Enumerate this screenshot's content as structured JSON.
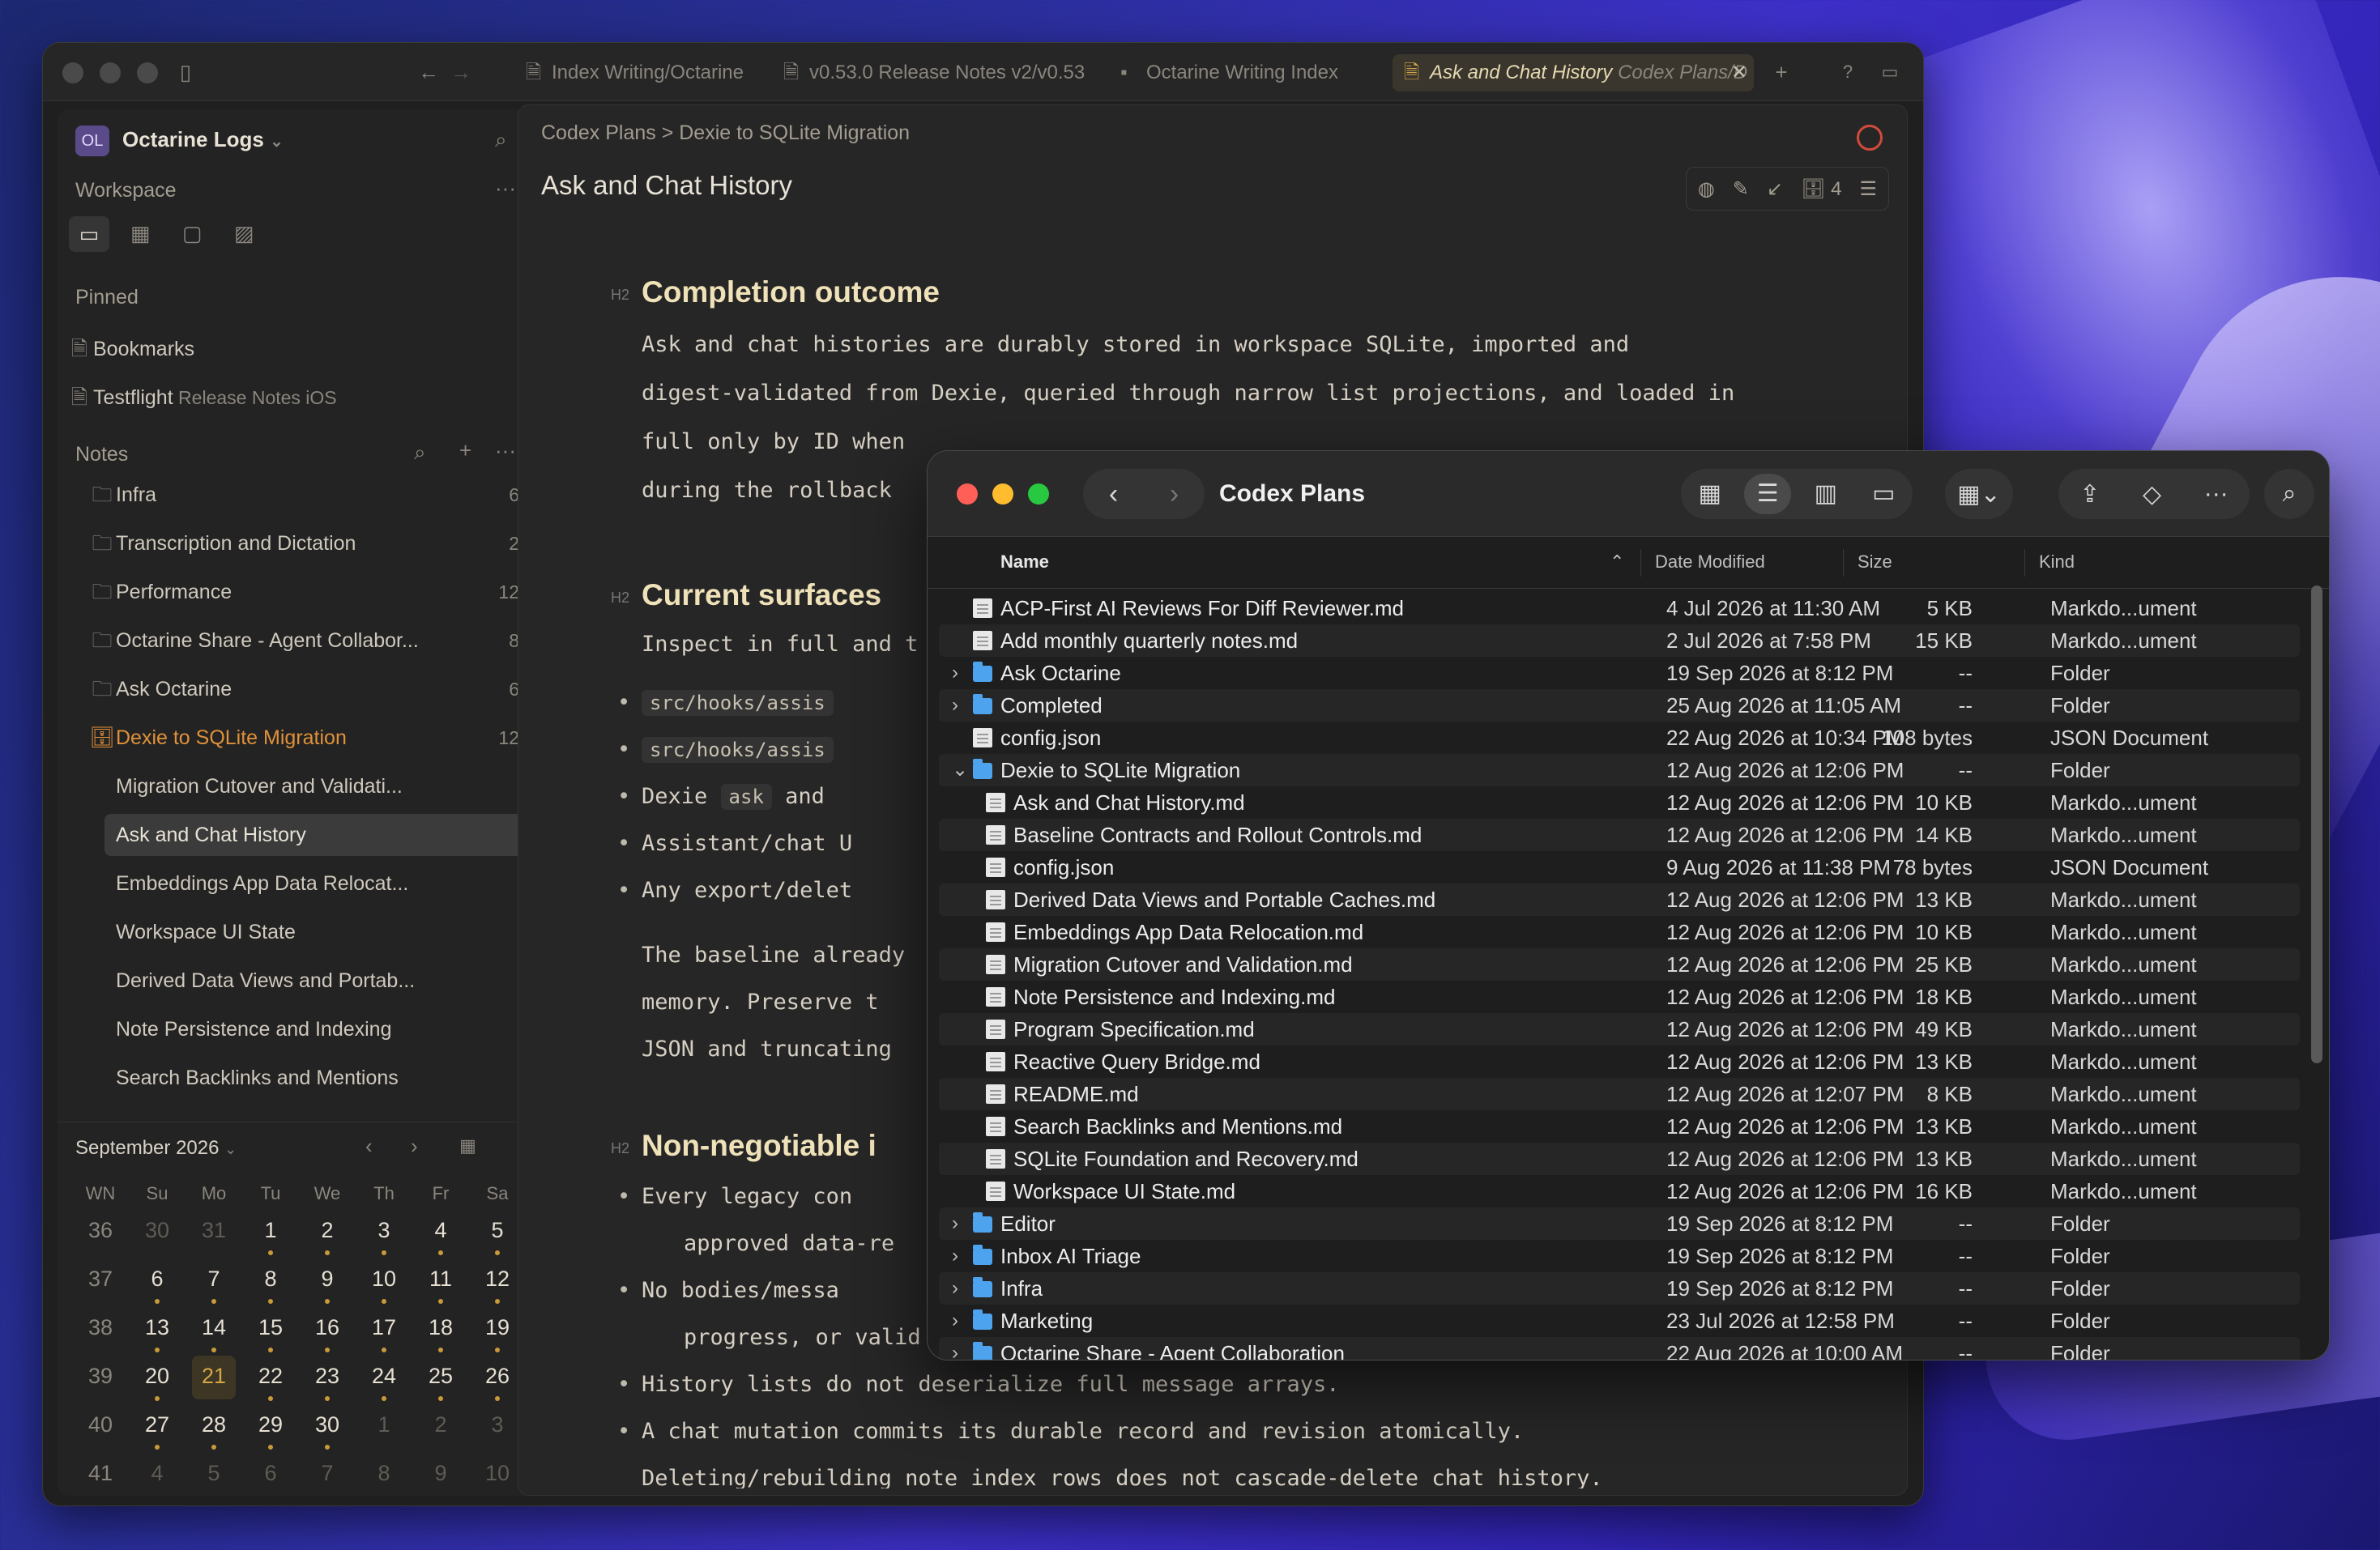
{
  "app": {
    "tabs": [
      {
        "label": "Index Writing/Octarine",
        "sub": "",
        "active": false
      },
      {
        "label": "v0.53.0 Release Notes v2/v0.53",
        "sub": "",
        "active": false
      },
      {
        "label": "Octarine Writing Index",
        "sub": "",
        "active": false
      },
      {
        "label": "Ask and Chat History",
        "sub": " Codex Plans/D",
        "active": true
      }
    ],
    "sidebar": {
      "workspace_badge": "OL",
      "workspace_name": "Octarine Logs",
      "workspace_label": "Workspace",
      "pinned_label": "Pinned",
      "pinned": [
        {
          "label": "Bookmarks",
          "sub": ""
        },
        {
          "label": "Testflight",
          "sub": " Release Notes iOS"
        }
      ],
      "notes_label": "Notes",
      "folders": [
        {
          "label": "Infra",
          "count": "6"
        },
        {
          "label": "Transcription and Dictation",
          "count": "2"
        },
        {
          "label": "Performance",
          "count": "12"
        },
        {
          "label": "Octarine Share - Agent Collabor...",
          "count": "8"
        },
        {
          "label": "Ask Octarine",
          "count": "6"
        },
        {
          "label": "Dexie to SQLite Migration",
          "count": "12"
        }
      ],
      "children": [
        "Migration Cutover and Validati...",
        "Ask and Chat History",
        "Embeddings App Data Relocat...",
        "Workspace UI State",
        "Derived Data Views and Portab...",
        "Note Persistence and Indexing",
        "Search Backlinks and Mentions"
      ],
      "calendar": {
        "month": "September 2026",
        "headers": [
          "WN",
          "Su",
          "Mo",
          "Tu",
          "We",
          "Th",
          "Fr",
          "Sa"
        ],
        "rows": [
          [
            "36",
            "30",
            "31",
            "1",
            "2",
            "3",
            "4",
            "5"
          ],
          [
            "37",
            "6",
            "7",
            "8",
            "9",
            "10",
            "11",
            "12"
          ],
          [
            "38",
            "13",
            "14",
            "15",
            "16",
            "17",
            "18",
            "19"
          ],
          [
            "39",
            "20",
            "21",
            "22",
            "23",
            "24",
            "25",
            "26"
          ],
          [
            "40",
            "27",
            "28",
            "29",
            "30",
            "1",
            "2",
            "3"
          ],
          [
            "41",
            "4",
            "5",
            "6",
            "7",
            "8",
            "9",
            "10"
          ]
        ]
      }
    },
    "editor": {
      "breadcrumb": "Codex Plans > Dexie to SQLite Migration",
      "title": "Ask and Chat History",
      "tool_count": "4",
      "h2_tag": "H2",
      "sections": {
        "s1_title": "Completion outcome",
        "s1_lines": [
          "Ask and chat histories are durably stored in workspace SQLite, imported and",
          "digest-validated from Dexie, queried through narrow list projections, and loaded in",
          "full only by ID when",
          "during the rollback"
        ],
        "s2_title": "Current surfaces",
        "s2_intro": "Inspect in full and t",
        "s2_b1": "src/hooks/assis",
        "s2_b2": "src/hooks/assis",
        "s2_b3a": "Dexie ",
        "s2_b3code": "ask",
        "s2_b3b": " and",
        "s2_b4": "Assistant/chat U",
        "s2_b5": "Any export/delet",
        "s2_p1": "The baseline already",
        "s2_p2": "memory. Preserve t",
        "s2_p3": "JSON and truncating",
        "s3_title": "Non-negotiable i",
        "s3_b1a": "Every legacy con",
        "s3_b1b": "approved data-re",
        "s3_b2a": "No bodies/messa",
        "s3_b2b": "progress, or valid",
        "s3_b3": "History lists do not deserialize full message arrays.",
        "s3_b4": "A chat mutation commits its durable record and revision atomically.",
        "s3_b5": "Deleting/rebuilding note index rows does not cascade-delete chat history."
      }
    }
  },
  "finder": {
    "title": "Codex Plans",
    "columns": {
      "name": "Name",
      "date": "Date Modified",
      "size": "Size",
      "kind": "Kind"
    },
    "rows": [
      {
        "name": "ACP-First AI Reviews For Diff Reviewer.md",
        "date": "4 Jul 2026 at 11:30 AM",
        "size": "5 KB",
        "kind": "Markdo...ument",
        "type": "file",
        "level": 0
      },
      {
        "name": "Add monthly quarterly notes.md",
        "date": "2 Jul 2026 at 7:58 PM",
        "size": "15 KB",
        "kind": "Markdo...ument",
        "type": "file",
        "level": 0
      },
      {
        "name": "Ask Octarine",
        "date": "19 Sep 2026 at 8:12 PM",
        "size": "--",
        "kind": "Folder",
        "type": "folder",
        "level": 0,
        "disc": "›"
      },
      {
        "name": "Completed",
        "date": "25 Aug 2026 at 11:05 AM",
        "size": "--",
        "kind": "Folder",
        "type": "folder",
        "level": 0,
        "disc": "›"
      },
      {
        "name": "config.json",
        "date": "22 Aug 2026 at 10:34 PM",
        "size": "108 bytes",
        "kind": "JSON Document",
        "type": "file",
        "level": 0
      },
      {
        "name": "Dexie to SQLite Migration",
        "date": "12 Aug 2026 at 12:06 PM",
        "size": "--",
        "kind": "Folder",
        "type": "folder",
        "level": 0,
        "disc": "⌄"
      },
      {
        "name": "Ask and Chat History.md",
        "date": "12 Aug 2026 at 12:06 PM",
        "size": "10 KB",
        "kind": "Markdo...ument",
        "type": "file",
        "level": 1
      },
      {
        "name": "Baseline Contracts and Rollout Controls.md",
        "date": "12 Aug 2026 at 12:06 PM",
        "size": "14 KB",
        "kind": "Markdo...ument",
        "type": "file",
        "level": 1
      },
      {
        "name": "config.json",
        "date": "9 Aug 2026 at 11:38 PM",
        "size": "78 bytes",
        "kind": "JSON Document",
        "type": "file",
        "level": 1
      },
      {
        "name": "Derived Data Views and Portable Caches.md",
        "date": "12 Aug 2026 at 12:06 PM",
        "size": "13 KB",
        "kind": "Markdo...ument",
        "type": "file",
        "level": 1
      },
      {
        "name": "Embeddings App Data Relocation.md",
        "date": "12 Aug 2026 at 12:06 PM",
        "size": "10 KB",
        "kind": "Markdo...ument",
        "type": "file",
        "level": 1
      },
      {
        "name": "Migration Cutover and Validation.md",
        "date": "12 Aug 2026 at 12:06 PM",
        "size": "25 KB",
        "kind": "Markdo...ument",
        "type": "file",
        "level": 1
      },
      {
        "name": "Note Persistence and Indexing.md",
        "date": "12 Aug 2026 at 12:06 PM",
        "size": "18 KB",
        "kind": "Markdo...ument",
        "type": "file",
        "level": 1
      },
      {
        "name": "Program Specification.md",
        "date": "12 Aug 2026 at 12:06 PM",
        "size": "49 KB",
        "kind": "Markdo...ument",
        "type": "file",
        "level": 1
      },
      {
        "name": "Reactive Query Bridge.md",
        "date": "12 Aug 2026 at 12:06 PM",
        "size": "13 KB",
        "kind": "Markdo...ument",
        "type": "file",
        "level": 1
      },
      {
        "name": "README.md",
        "date": "12 Aug 2026 at 12:07 PM",
        "size": "8 KB",
        "kind": "Markdo...ument",
        "type": "file",
        "level": 1
      },
      {
        "name": "Search Backlinks and Mentions.md",
        "date": "12 Aug 2026 at 12:06 PM",
        "size": "13 KB",
        "kind": "Markdo...ument",
        "type": "file",
        "level": 1
      },
      {
        "name": "SQLite Foundation and Recovery.md",
        "date": "12 Aug 2026 at 12:06 PM",
        "size": "13 KB",
        "kind": "Markdo...ument",
        "type": "file",
        "level": 1
      },
      {
        "name": "Workspace UI State.md",
        "date": "12 Aug 2026 at 12:06 PM",
        "size": "16 KB",
        "kind": "Markdo...ument",
        "type": "file",
        "level": 1
      },
      {
        "name": "Editor",
        "date": "19 Sep 2026 at 8:12 PM",
        "size": "--",
        "kind": "Folder",
        "type": "folder",
        "level": 0,
        "disc": "›"
      },
      {
        "name": "Inbox AI Triage",
        "date": "19 Sep 2026 at 8:12 PM",
        "size": "--",
        "kind": "Folder",
        "type": "folder",
        "level": 0,
        "disc": "›"
      },
      {
        "name": "Infra",
        "date": "19 Sep 2026 at 8:12 PM",
        "size": "--",
        "kind": "Folder",
        "type": "folder",
        "level": 0,
        "disc": "›"
      },
      {
        "name": "Marketing",
        "date": "23 Jul 2026 at 12:58 PM",
        "size": "--",
        "kind": "Folder",
        "type": "folder",
        "level": 0,
        "disc": "›"
      },
      {
        "name": "Octarine Share - Agent Collaboration",
        "date": "22 Aug 2026 at 10:00 AM",
        "size": "--",
        "kind": "Folder",
        "type": "folder",
        "level": 0,
        "disc": "›"
      }
    ]
  },
  "colors": {
    "accent": "#d4a746",
    "active_folder": "#e0913a",
    "finder_folder": "#4da3ee"
  }
}
